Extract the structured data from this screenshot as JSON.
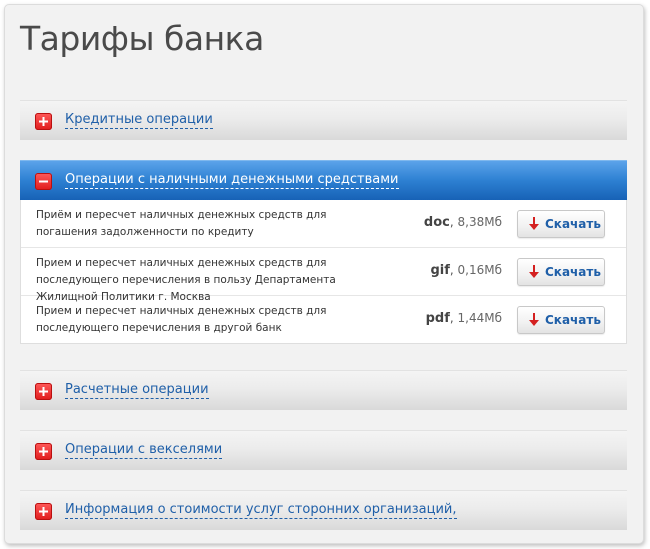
{
  "page": {
    "title": "Тарифы банка"
  },
  "sections": [
    {
      "label": "Кредитные операции",
      "expanded": false
    },
    {
      "label": "Операции с наличными денежными средствами",
      "expanded": true,
      "documents": [
        {
          "description": "Приём и пересчет наличных денежных средств для погашения задолженности по кредиту",
          "format": "doc",
          "size": "8,38Мб",
          "button": "Скачать"
        },
        {
          "description": "Прием и пересчет наличных денежных средств для последующего перечисления в пользу Департамента Жилищной Политики г. Москва",
          "format": "gif",
          "size": "0,16Мб",
          "button": "Скачать"
        },
        {
          "description": "Прием и пересчет наличных денежных средств для последующего перечисления в другой банк",
          "format": "pdf",
          "size": "1,44Мб",
          "button": "Скачать"
        }
      ]
    },
    {
      "label": "Расчетные операции",
      "expanded": false
    },
    {
      "label": "Операции с векселями",
      "expanded": false
    },
    {
      "label": "Информация о стоимости услуг сторонних организаций,",
      "expanded": false
    }
  ],
  "colors": {
    "accent": "#2d80d2",
    "toggle": "#e01b1b",
    "link": "#1f5fa8",
    "download_arrow": "#d42020"
  },
  "icons": {
    "expand": "plus-icon",
    "collapse": "minus-icon",
    "download": "download-arrow-icon"
  }
}
